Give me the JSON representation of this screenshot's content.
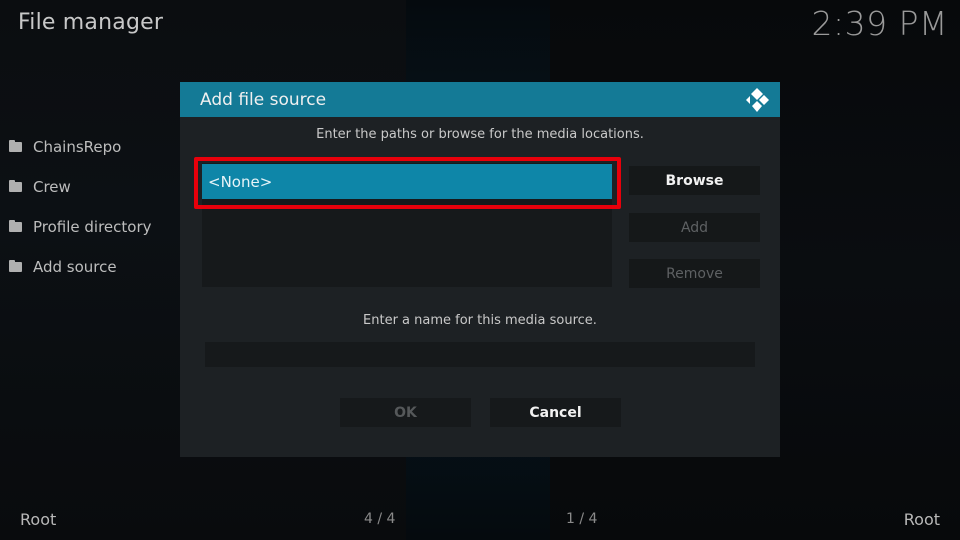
{
  "header": {
    "title": "File manager",
    "clock": "2:39 PM"
  },
  "sidebar": {
    "items": [
      {
        "label": "ChainsRepo",
        "icon": "folder-icon"
      },
      {
        "label": "Crew",
        "icon": "folder-icon"
      },
      {
        "label": "Profile directory",
        "icon": "folder-icon"
      },
      {
        "label": "Add source",
        "icon": "folder-icon"
      }
    ]
  },
  "footer": {
    "left_label": "Root",
    "left_count": "4 / 4",
    "right_count": "1 / 4",
    "right_label": "Root"
  },
  "dialog": {
    "title": "Add file source",
    "logo_icon": "kodi-logo-icon",
    "paths_instruction": "Enter the paths or browse for the media locations.",
    "paths": [
      "<None>"
    ],
    "buttons": {
      "browse": "Browse",
      "add": "Add",
      "remove": "Remove",
      "ok": "OK",
      "cancel": "Cancel"
    },
    "name_instruction": "Enter a name for this media source.",
    "name_value": ""
  },
  "colors": {
    "accent": "#147a96",
    "selected_item": "#0e86a8",
    "highlight_annotation": "#e8000b",
    "dialog_bg": "#1d2124"
  }
}
